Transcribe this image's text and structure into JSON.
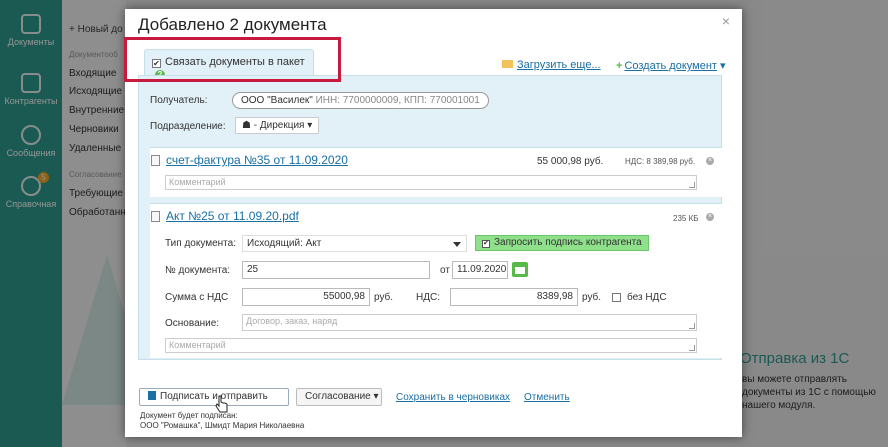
{
  "app": {
    "sidebar": [
      {
        "label": "Документы",
        "icon": "documents-icon"
      },
      {
        "label": "Контрагенты",
        "icon": "contacts-icon"
      },
      {
        "label": "Сообщения",
        "icon": "messages-icon"
      },
      {
        "label": "Справочная",
        "icon": "lightbulb-icon",
        "badge": "5"
      }
    ],
    "menu": {
      "new_doc": "Новый до",
      "group1": "Документооб",
      "items1": [
        "Входящие",
        "Исходящие",
        "Внутренние",
        "Черновики",
        "Удаленные"
      ],
      "group2": "Согласование",
      "items2": [
        "Требующие с",
        "Обработанн"
      ]
    },
    "promo": {
      "title": "Отправка из 1С",
      "lines": [
        "вы можете отправлять",
        "документы из 1С с помощью",
        "нашего модуля."
      ]
    }
  },
  "modal": {
    "title": "Добавлено 2 документа",
    "close": "×",
    "link_package_label": "Связать документы в пакет",
    "help": "?",
    "upload_more": "Загрузить еще...",
    "create_doc": "Создать документ",
    "recipient_label": "Получатель:",
    "recipient_name": "ООО \"Василек\"",
    "recipient_details": "ИНН: 7700000009, КПП: 770001001",
    "department_label": "Подразделение:",
    "department_value": "- Дирекция",
    "doc1": {
      "title": "счет-фактура №35 от 11.09.2020",
      "amount": "55 000,98 руб.",
      "vat": "НДС: 8 389,98 руб.",
      "comment_placeholder": "Комментарий"
    },
    "doc2": {
      "title": "Акт №25 от 11.09.20.pdf",
      "size": "235 КБ",
      "type_label": "Тип документа:",
      "type_value": "Исходящий: Акт",
      "request_sign": "Запросить подпись контрагента",
      "number_label": "№ документа:",
      "number_value": "25",
      "date_label": "от",
      "date_value": "11.09.2020",
      "sum_label": "Сумма с НДС",
      "sum_value": "55000,98",
      "currency": "руб.",
      "vat_label": "НДС:",
      "vat_value": "8389,98",
      "vat_currency": "руб.",
      "no_vat": "без НДС",
      "basis_label": "Основание:",
      "basis_placeholder": "Договор, заказ, наряд",
      "comment_placeholder": "Комментарий"
    },
    "footer": {
      "sign_send": "Подписать и отправить",
      "approval": "Согласование",
      "save_draft": "Сохранить в черновиках",
      "cancel": "Отменить",
      "note_line1": "Документ будет подписан:",
      "note_line2": "ООО \"Ромашка\", Шмидт Мария Николаевна"
    }
  }
}
